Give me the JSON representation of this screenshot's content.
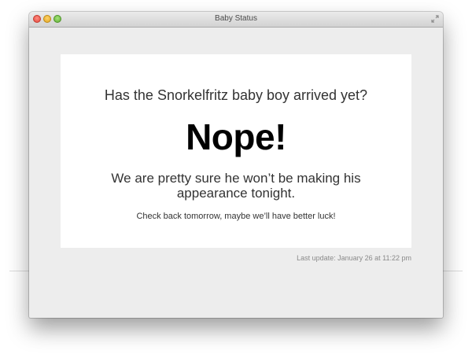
{
  "window": {
    "title": "Baby Status"
  },
  "status": {
    "question": "Has the Snorkelfritz baby boy arrived yet?",
    "answer": "Nope!",
    "explanation": "We are pretty sure he won’t be making his appearance tonight.",
    "followup": "Check back tomorrow, maybe we’ll have better luck!",
    "last_update": "Last update: January 26 at 11:22 pm"
  },
  "icons": {
    "close": "close-icon",
    "minimize": "minimize-icon",
    "zoom": "zoom-icon",
    "fullscreen": "fullscreen-icon"
  },
  "colors": {
    "close": "#e2473b",
    "minimize": "#e0a520",
    "zoom": "#5fae35",
    "card_background": "#ffffff",
    "window_background": "#ededed"
  }
}
